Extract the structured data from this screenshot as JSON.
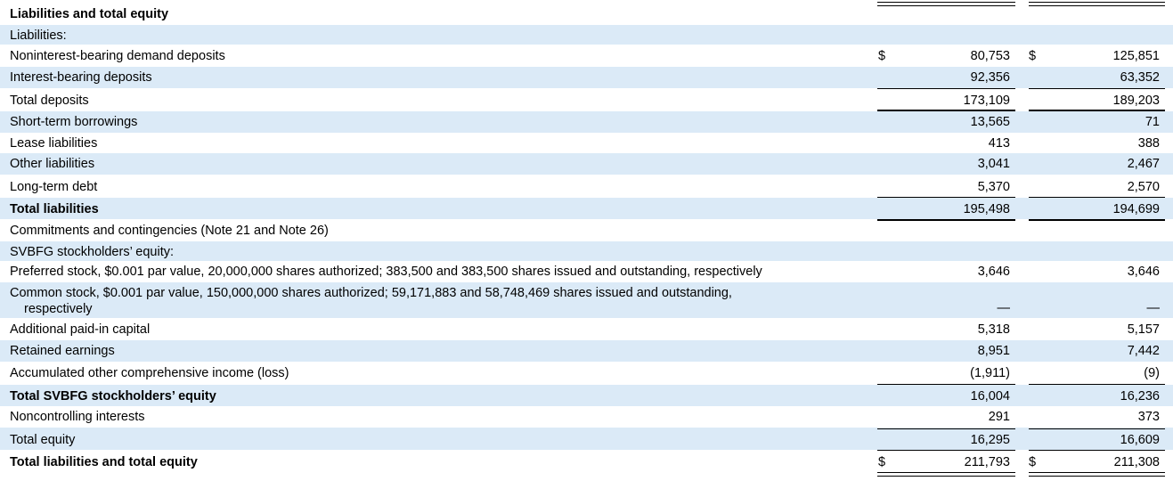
{
  "heading": "Liabilities and total equity",
  "rows": [
    {
      "label": "Liabilities:",
      "c1": "",
      "c2": ""
    },
    {
      "label": "Noninterest-bearing demand deposits",
      "c1_sym": "$",
      "c1": "80,753",
      "c2_sym": "$",
      "c2": "125,851"
    },
    {
      "label": "Interest-bearing deposits",
      "c1": "92,356",
      "c2": "63,352"
    },
    {
      "label": "Total deposits",
      "c1": "173,109",
      "c2": "189,203"
    },
    {
      "label": "Short-term borrowings",
      "c1": "13,565",
      "c2": "71"
    },
    {
      "label": "Lease liabilities",
      "c1": "413",
      "c2": "388"
    },
    {
      "label": "Other liabilities",
      "c1": "3,041",
      "c2": "2,467"
    },
    {
      "label": "Long-term debt",
      "c1": "5,370",
      "c2": "2,570"
    },
    {
      "label": "Total liabilities",
      "c1": "195,498",
      "c2": "194,699"
    },
    {
      "label": "Commitments and contingencies (Note 21 and Note 26)",
      "c1": "",
      "c2": ""
    },
    {
      "label": "SVBFG stockholders’ equity:",
      "c1": "",
      "c2": ""
    },
    {
      "label": "Preferred stock, $0.001 par value, 20,000,000 shares authorized; 383,500 and 383,500 shares issued and outstanding, respectively",
      "c1": "3,646",
      "c2": "3,646"
    },
    {
      "label": "Common stock, $0.001 par value, 150,000,000 shares authorized; 59,171,883 and 58,748,469 shares issued and outstanding,",
      "label_cont": "respectively",
      "c1": "—",
      "c2": "—"
    },
    {
      "label": "Additional paid-in capital",
      "c1": "5,318",
      "c2": "5,157"
    },
    {
      "label": "Retained earnings",
      "c1": "8,951",
      "c2": "7,442"
    },
    {
      "label": "Accumulated other comprehensive income (loss)",
      "c1": "(1,911)",
      "c2": "(9)"
    },
    {
      "label": "Total SVBFG stockholders’ equity",
      "c1": "16,004",
      "c2": "16,236"
    },
    {
      "label": "Noncontrolling interests",
      "c1": "291",
      "c2": "373"
    },
    {
      "label": "Total equity",
      "c1": "16,295",
      "c2": "16,609"
    },
    {
      "label": "Total liabilities and total equity",
      "c1_sym": "$",
      "c1": "211,793",
      "c2_sym": "$",
      "c2": "211,308"
    }
  ]
}
